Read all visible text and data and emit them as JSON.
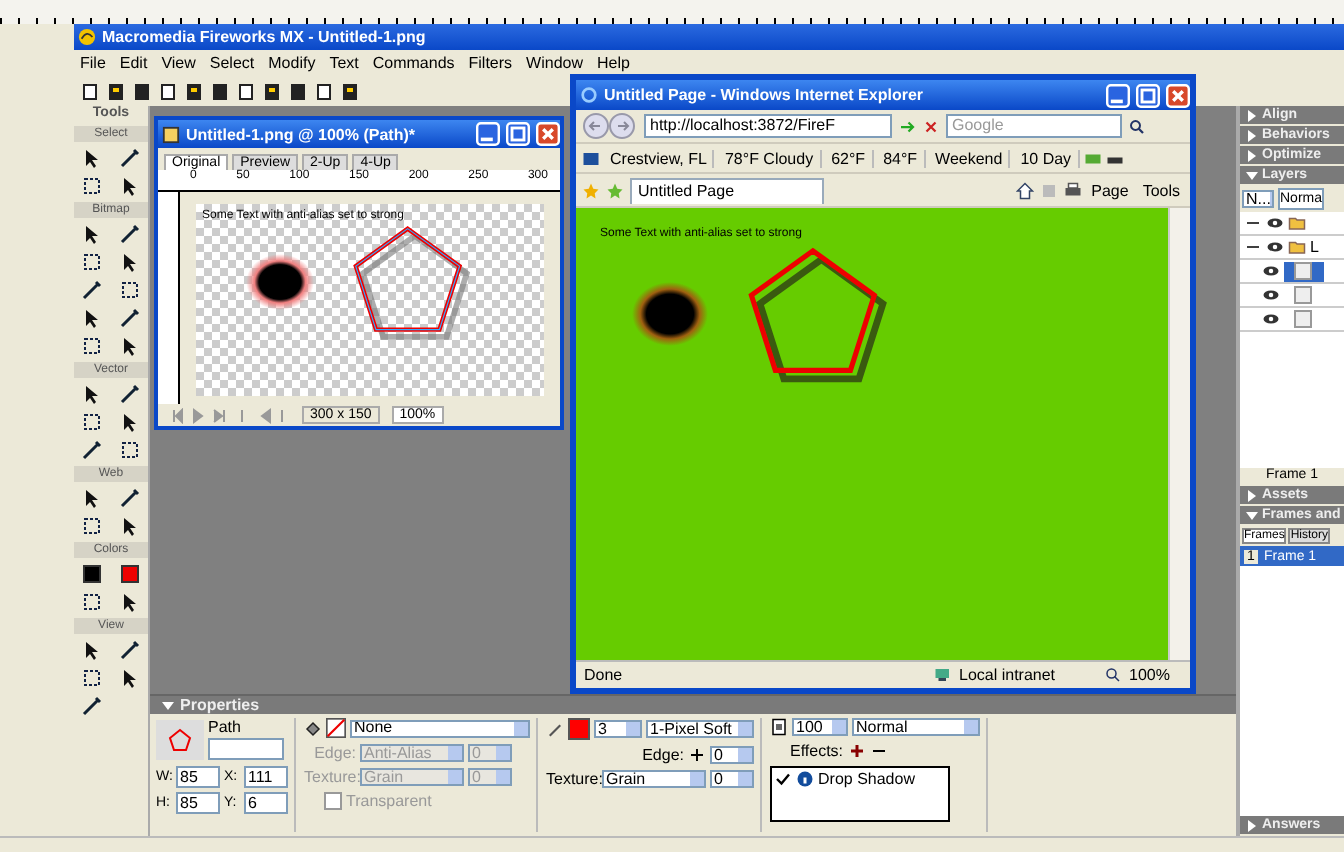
{
  "app": {
    "title": "Macromedia Fireworks MX - Untitled-1.png",
    "menu": [
      "File",
      "Edit",
      "View",
      "Select",
      "Modify",
      "Text",
      "Commands",
      "Filters",
      "Window",
      "Help"
    ]
  },
  "tools": {
    "title": "Tools",
    "sections": [
      "Select",
      "Bitmap",
      "Vector",
      "Web",
      "Colors",
      "View"
    ]
  },
  "document": {
    "title": "Untitled-1.png @ 100% (Path)*",
    "tabs": [
      {
        "label": "Original",
        "selected": true
      },
      {
        "label": "Preview",
        "selected": false
      },
      {
        "label": "2-Up",
        "selected": false
      },
      {
        "label": "4-Up",
        "selected": false
      }
    ],
    "ruler": [
      "0",
      "50",
      "100",
      "150",
      "200",
      "250",
      "300"
    ],
    "canvas_text": "Some Text with anti-alias set to strong",
    "size": "300 x 150",
    "zoom": "100%"
  },
  "browser": {
    "title": "Untitled Page - Windows Internet Explorer",
    "address": "http://localhost:3872/FireF",
    "search_placeholder": "Google",
    "links": [
      "Crestview, FL",
      "78°F Cloudy",
      "62°F",
      "84°F",
      "Weekend",
      "10 Day"
    ],
    "tab": "Untitled Page",
    "commands": [
      "Page",
      "Tools"
    ],
    "content_text": "Some Text with anti-alias set to strong",
    "status": "Done",
    "zone": "Local intranet",
    "zoom": "100%"
  },
  "panels": [
    {
      "title": "Align",
      "expanded": false,
      "kind": "plain"
    },
    {
      "title": "Behaviors",
      "expanded": false,
      "kind": "plain"
    },
    {
      "title": "Optimize",
      "expanded": false,
      "kind": "plain"
    },
    {
      "title": "Layers",
      "expanded": true,
      "kind": "layers"
    },
    {
      "title": "Assets",
      "expanded": false,
      "kind": "plain"
    },
    {
      "title": "Frames and",
      "expanded": true,
      "kind": "frames"
    },
    {
      "title": "Answers",
      "expanded": false,
      "kind": "plain"
    }
  ],
  "layers": {
    "opacity": "N...",
    "blend": "Norma",
    "footer": "Frame 1",
    "items": [
      {
        "kind": "folder",
        "expanded": true
      },
      {
        "kind": "folder",
        "expanded": true,
        "name": "L",
        "children": [
          {
            "kind": "object",
            "selected": true
          },
          {
            "kind": "object",
            "selected": false
          },
          {
            "kind": "object",
            "selected": false
          }
        ]
      }
    ]
  },
  "frames": {
    "tabs": [
      {
        "label": "Frames",
        "selected": true
      },
      {
        "label": "History",
        "selected": false
      }
    ],
    "items": [
      {
        "number": "1",
        "name": "Frame 1",
        "selected": true
      }
    ]
  },
  "properties": {
    "title": "Properties",
    "object_kind": "Path",
    "dims": [
      {
        "label": "W:",
        "value": "85"
      },
      {
        "label": "X:",
        "value": "111"
      },
      {
        "label": "H:",
        "value": "85"
      },
      {
        "label": "Y:",
        "value": "6"
      }
    ],
    "fill": {
      "type": "None",
      "edge_label": "Edge:",
      "edge": "Anti-Alias",
      "edge_amount": "0",
      "texture_label": "Texture:",
      "texture": "Grain",
      "texture_amount": "0",
      "transparent_label": "Transparent",
      "transparent": false,
      "disabled": true
    },
    "stroke": {
      "color": "#ff0000",
      "size": "3",
      "type": "1-Pixel Soft",
      "edge_label": "Edge:",
      "edge": "0",
      "texture_label": "Texture:",
      "texture": "Grain",
      "texture_amount": "0"
    },
    "effects": {
      "opacity": "100",
      "blend": "Normal",
      "label": "Effects:",
      "items": [
        {
          "name": "Drop Shadow",
          "enabled": true
        }
      ]
    }
  }
}
